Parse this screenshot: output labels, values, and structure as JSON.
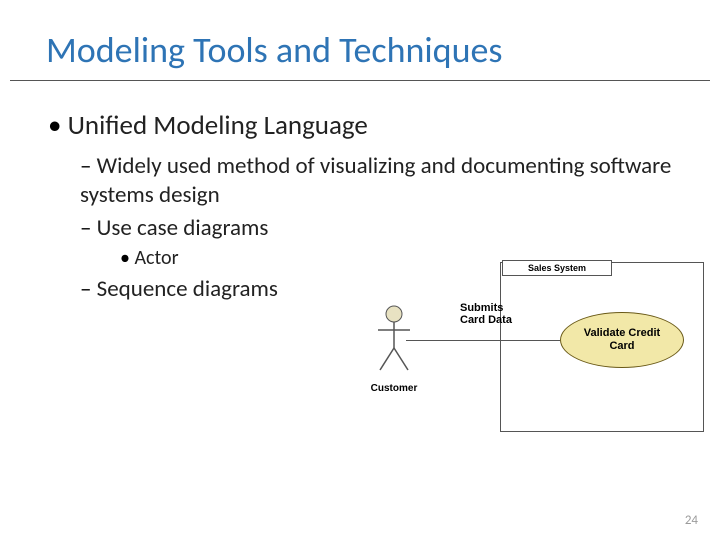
{
  "title": "Modeling Tools and Techniques",
  "bullets": {
    "lvl1": "Unified Modeling Language",
    "lvl2a": "Widely used method of visualizing and documenting software systems design",
    "lvl2b": "Use case diagrams",
    "lvl3a": "Actor",
    "lvl2c": "Sequence diagrams"
  },
  "diagram": {
    "system_label": "Sales System",
    "actor_label": "Customer",
    "assoc_label": "Submits\nCard Data",
    "usecase_label": "Validate Credit\nCard"
  },
  "pagenum": "24"
}
